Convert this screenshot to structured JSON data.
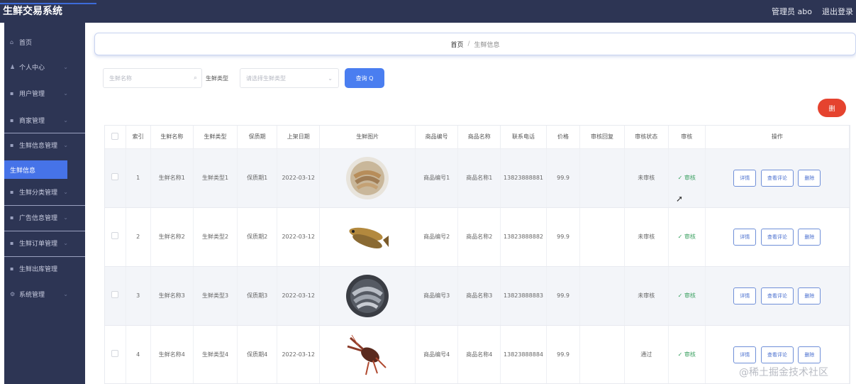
{
  "app": {
    "title": "生鲜交易系统"
  },
  "header": {
    "admin_label": "管理员 abo",
    "logout_label": "退出登录"
  },
  "sidebar": {
    "items": [
      {
        "icon": "home-icon",
        "label": "首页"
      },
      {
        "icon": "user-icon",
        "label": "个人中心"
      },
      {
        "icon": "grid-icon",
        "label": "用户管理"
      },
      {
        "icon": "grid-icon",
        "label": "商家管理"
      },
      {
        "icon": "grid-icon",
        "label": "生鲜信息管理"
      },
      {
        "icon": "grid-icon",
        "label": "生鲜分类管理"
      },
      {
        "icon": "grid-icon",
        "label": "广告信息管理"
      },
      {
        "icon": "grid-icon",
        "label": "生鲜订单管理"
      },
      {
        "icon": "grid-icon",
        "label": "生鲜出库管理"
      },
      {
        "icon": "gear-icon",
        "label": "系统管理"
      }
    ],
    "active_sub": "生鲜信息"
  },
  "breadcrumb": {
    "home": "首页",
    "current": "生鲜信息"
  },
  "search": {
    "name_placeholder": "生鲜名称",
    "type_label": "生鲜类型",
    "type_placeholder": "请选择生鲜类型",
    "query_label": "查询 Q"
  },
  "delete_button_label": "删",
  "table": {
    "headers": [
      "",
      "索引",
      "生鲜名称",
      "生鲜类型",
      "保质期",
      "上架日期",
      "生鲜图片",
      "商品编号",
      "商品名称",
      "联系电话",
      "价格",
      "审核回复",
      "审核状态",
      "审核",
      "操作"
    ],
    "rows": [
      {
        "index": "1",
        "name": "生鲜名称1",
        "type": "生鲜类型1",
        "shelf": "保质期1",
        "date": "2022-03-12",
        "image": "shrimp-bowl-image",
        "code": "商品编号1",
        "product": "商品名称1",
        "phone": "13823888881",
        "price": "99.9",
        "reply": "",
        "status": "未审核",
        "audit": "✓ 审核"
      },
      {
        "index": "2",
        "name": "生鲜名称2",
        "type": "生鲜类型2",
        "shelf": "保质期2",
        "date": "2022-03-12",
        "image": "fish-image",
        "code": "商品编号2",
        "product": "商品名称2",
        "phone": "13823888882",
        "price": "99.9",
        "reply": "",
        "status": "未审核",
        "audit": "✓ 审核"
      },
      {
        "index": "3",
        "name": "生鲜名称3",
        "type": "生鲜类型3",
        "shelf": "保质期3",
        "date": "2022-03-12",
        "image": "shrimp-plate-image",
        "code": "商品编号3",
        "product": "商品名称3",
        "phone": "13823888883",
        "price": "99.9",
        "reply": "",
        "status": "未审核",
        "audit": "✓ 审核"
      },
      {
        "index": "4",
        "name": "生鲜名称4",
        "type": "生鲜类型4",
        "shelf": "保质期4",
        "date": "2022-03-12",
        "image": "crayfish-image",
        "code": "商品编号4",
        "product": "商品名称4",
        "phone": "13823888884",
        "price": "99.9",
        "reply": "",
        "status": "通过",
        "audit": "✓ 审核"
      }
    ],
    "ops": {
      "detail": "详情",
      "comment": "查看评论",
      "delete": "删除"
    }
  },
  "watermark": "@稀土掘金技术社区"
}
